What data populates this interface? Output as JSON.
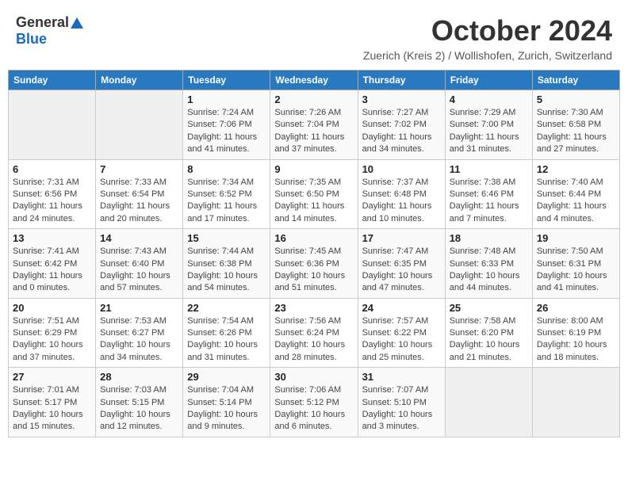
{
  "logo": {
    "general": "General",
    "blue": "Blue"
  },
  "title": "October 2024",
  "subtitle": "Zuerich (Kreis 2) / Wollishofen, Zurich, Switzerland",
  "days_of_week": [
    "Sunday",
    "Monday",
    "Tuesday",
    "Wednesday",
    "Thursday",
    "Friday",
    "Saturday"
  ],
  "weeks": [
    [
      {
        "day": "",
        "sunrise": "",
        "sunset": "",
        "daylight": ""
      },
      {
        "day": "",
        "sunrise": "",
        "sunset": "",
        "daylight": ""
      },
      {
        "day": "1",
        "sunrise": "Sunrise: 7:24 AM",
        "sunset": "Sunset: 7:06 PM",
        "daylight": "Daylight: 11 hours and 41 minutes."
      },
      {
        "day": "2",
        "sunrise": "Sunrise: 7:26 AM",
        "sunset": "Sunset: 7:04 PM",
        "daylight": "Daylight: 11 hours and 37 minutes."
      },
      {
        "day": "3",
        "sunrise": "Sunrise: 7:27 AM",
        "sunset": "Sunset: 7:02 PM",
        "daylight": "Daylight: 11 hours and 34 minutes."
      },
      {
        "day": "4",
        "sunrise": "Sunrise: 7:29 AM",
        "sunset": "Sunset: 7:00 PM",
        "daylight": "Daylight: 11 hours and 31 minutes."
      },
      {
        "day": "5",
        "sunrise": "Sunrise: 7:30 AM",
        "sunset": "Sunset: 6:58 PM",
        "daylight": "Daylight: 11 hours and 27 minutes."
      }
    ],
    [
      {
        "day": "6",
        "sunrise": "Sunrise: 7:31 AM",
        "sunset": "Sunset: 6:56 PM",
        "daylight": "Daylight: 11 hours and 24 minutes."
      },
      {
        "day": "7",
        "sunrise": "Sunrise: 7:33 AM",
        "sunset": "Sunset: 6:54 PM",
        "daylight": "Daylight: 11 hours and 20 minutes."
      },
      {
        "day": "8",
        "sunrise": "Sunrise: 7:34 AM",
        "sunset": "Sunset: 6:52 PM",
        "daylight": "Daylight: 11 hours and 17 minutes."
      },
      {
        "day": "9",
        "sunrise": "Sunrise: 7:35 AM",
        "sunset": "Sunset: 6:50 PM",
        "daylight": "Daylight: 11 hours and 14 minutes."
      },
      {
        "day": "10",
        "sunrise": "Sunrise: 7:37 AM",
        "sunset": "Sunset: 6:48 PM",
        "daylight": "Daylight: 11 hours and 10 minutes."
      },
      {
        "day": "11",
        "sunrise": "Sunrise: 7:38 AM",
        "sunset": "Sunset: 6:46 PM",
        "daylight": "Daylight: 11 hours and 7 minutes."
      },
      {
        "day": "12",
        "sunrise": "Sunrise: 7:40 AM",
        "sunset": "Sunset: 6:44 PM",
        "daylight": "Daylight: 11 hours and 4 minutes."
      }
    ],
    [
      {
        "day": "13",
        "sunrise": "Sunrise: 7:41 AM",
        "sunset": "Sunset: 6:42 PM",
        "daylight": "Daylight: 11 hours and 0 minutes."
      },
      {
        "day": "14",
        "sunrise": "Sunrise: 7:43 AM",
        "sunset": "Sunset: 6:40 PM",
        "daylight": "Daylight: 10 hours and 57 minutes."
      },
      {
        "day": "15",
        "sunrise": "Sunrise: 7:44 AM",
        "sunset": "Sunset: 6:38 PM",
        "daylight": "Daylight: 10 hours and 54 minutes."
      },
      {
        "day": "16",
        "sunrise": "Sunrise: 7:45 AM",
        "sunset": "Sunset: 6:36 PM",
        "daylight": "Daylight: 10 hours and 51 minutes."
      },
      {
        "day": "17",
        "sunrise": "Sunrise: 7:47 AM",
        "sunset": "Sunset: 6:35 PM",
        "daylight": "Daylight: 10 hours and 47 minutes."
      },
      {
        "day": "18",
        "sunrise": "Sunrise: 7:48 AM",
        "sunset": "Sunset: 6:33 PM",
        "daylight": "Daylight: 10 hours and 44 minutes."
      },
      {
        "day": "19",
        "sunrise": "Sunrise: 7:50 AM",
        "sunset": "Sunset: 6:31 PM",
        "daylight": "Daylight: 10 hours and 41 minutes."
      }
    ],
    [
      {
        "day": "20",
        "sunrise": "Sunrise: 7:51 AM",
        "sunset": "Sunset: 6:29 PM",
        "daylight": "Daylight: 10 hours and 37 minutes."
      },
      {
        "day": "21",
        "sunrise": "Sunrise: 7:53 AM",
        "sunset": "Sunset: 6:27 PM",
        "daylight": "Daylight: 10 hours and 34 minutes."
      },
      {
        "day": "22",
        "sunrise": "Sunrise: 7:54 AM",
        "sunset": "Sunset: 6:26 PM",
        "daylight": "Daylight: 10 hours and 31 minutes."
      },
      {
        "day": "23",
        "sunrise": "Sunrise: 7:56 AM",
        "sunset": "Sunset: 6:24 PM",
        "daylight": "Daylight: 10 hours and 28 minutes."
      },
      {
        "day": "24",
        "sunrise": "Sunrise: 7:57 AM",
        "sunset": "Sunset: 6:22 PM",
        "daylight": "Daylight: 10 hours and 25 minutes."
      },
      {
        "day": "25",
        "sunrise": "Sunrise: 7:58 AM",
        "sunset": "Sunset: 6:20 PM",
        "daylight": "Daylight: 10 hours and 21 minutes."
      },
      {
        "day": "26",
        "sunrise": "Sunrise: 8:00 AM",
        "sunset": "Sunset: 6:19 PM",
        "daylight": "Daylight: 10 hours and 18 minutes."
      }
    ],
    [
      {
        "day": "27",
        "sunrise": "Sunrise: 7:01 AM",
        "sunset": "Sunset: 5:17 PM",
        "daylight": "Daylight: 10 hours and 15 minutes."
      },
      {
        "day": "28",
        "sunrise": "Sunrise: 7:03 AM",
        "sunset": "Sunset: 5:15 PM",
        "daylight": "Daylight: 10 hours and 12 minutes."
      },
      {
        "day": "29",
        "sunrise": "Sunrise: 7:04 AM",
        "sunset": "Sunset: 5:14 PM",
        "daylight": "Daylight: 10 hours and 9 minutes."
      },
      {
        "day": "30",
        "sunrise": "Sunrise: 7:06 AM",
        "sunset": "Sunset: 5:12 PM",
        "daylight": "Daylight: 10 hours and 6 minutes."
      },
      {
        "day": "31",
        "sunrise": "Sunrise: 7:07 AM",
        "sunset": "Sunset: 5:10 PM",
        "daylight": "Daylight: 10 hours and 3 minutes."
      },
      {
        "day": "",
        "sunrise": "",
        "sunset": "",
        "daylight": ""
      },
      {
        "day": "",
        "sunrise": "",
        "sunset": "",
        "daylight": ""
      }
    ]
  ]
}
